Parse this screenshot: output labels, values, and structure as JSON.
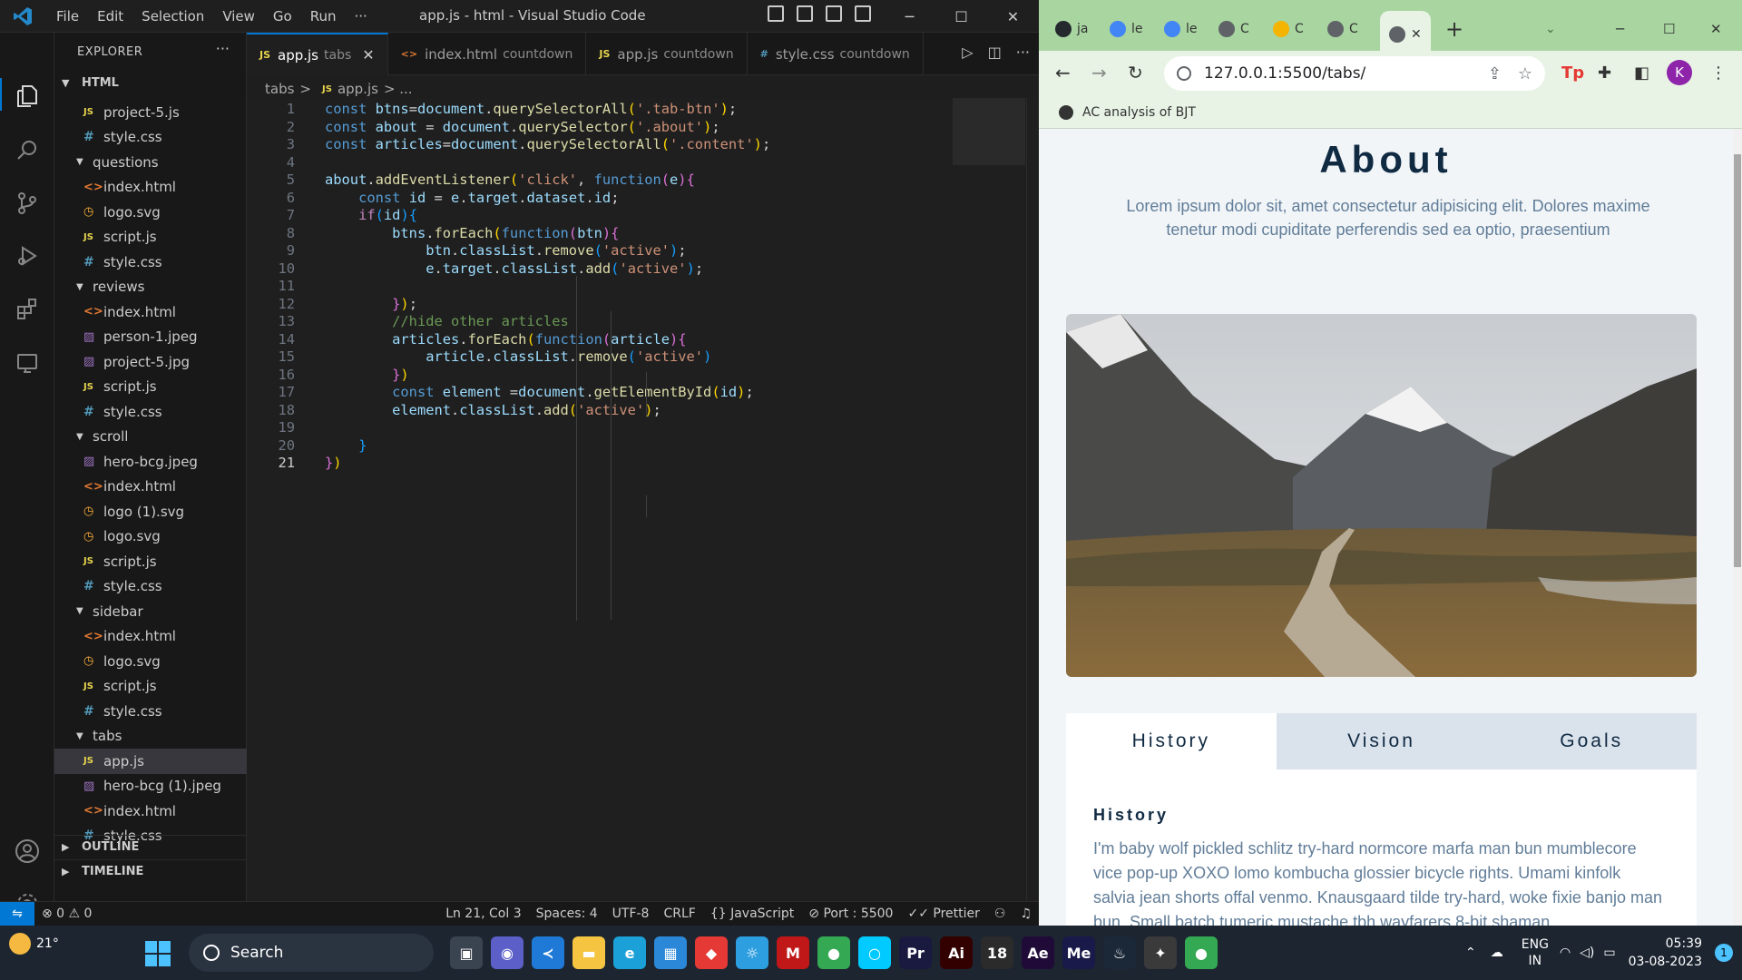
{
  "vscode": {
    "menu": [
      "File",
      "Edit",
      "Selection",
      "View",
      "Go",
      "Run",
      "···"
    ],
    "title": "app.js - html - Visual Studio Code",
    "explorer_title": "EXPLORER",
    "more": "···",
    "root_folder": "HTML",
    "tree": [
      {
        "type": "file",
        "icon": "js",
        "name": "project-5.js"
      },
      {
        "type": "file",
        "icon": "css",
        "name": "style.css"
      },
      {
        "type": "folder",
        "name": "questions"
      },
      {
        "type": "file",
        "icon": "html",
        "name": "index.html"
      },
      {
        "type": "file",
        "icon": "svg",
        "name": "logo.svg"
      },
      {
        "type": "file",
        "icon": "js",
        "name": "script.js"
      },
      {
        "type": "file",
        "icon": "css",
        "name": "style.css"
      },
      {
        "type": "folder",
        "name": "reviews"
      },
      {
        "type": "file",
        "icon": "html",
        "name": "index.html"
      },
      {
        "type": "file",
        "icon": "img",
        "name": "person-1.jpeg"
      },
      {
        "type": "file",
        "icon": "img",
        "name": "project-5.jpg"
      },
      {
        "type": "file",
        "icon": "js",
        "name": "script.js"
      },
      {
        "type": "file",
        "icon": "css",
        "name": "style.css"
      },
      {
        "type": "folder",
        "name": "scroll"
      },
      {
        "type": "file",
        "icon": "img",
        "name": "hero-bcg.jpeg"
      },
      {
        "type": "file",
        "icon": "html",
        "name": "index.html"
      },
      {
        "type": "file",
        "icon": "svg",
        "name": "logo (1).svg"
      },
      {
        "type": "file",
        "icon": "svg",
        "name": "logo.svg"
      },
      {
        "type": "file",
        "icon": "js",
        "name": "script.js"
      },
      {
        "type": "file",
        "icon": "css",
        "name": "style.css"
      },
      {
        "type": "folder",
        "name": "sidebar"
      },
      {
        "type": "file",
        "icon": "html",
        "name": "index.html"
      },
      {
        "type": "file",
        "icon": "svg",
        "name": "logo.svg"
      },
      {
        "type": "file",
        "icon": "js",
        "name": "script.js"
      },
      {
        "type": "file",
        "icon": "css",
        "name": "style.css"
      },
      {
        "type": "folder",
        "name": "tabs"
      },
      {
        "type": "file",
        "icon": "js",
        "name": "app.js",
        "selected": true
      },
      {
        "type": "file",
        "icon": "img",
        "name": "hero-bcg (1).jpeg"
      },
      {
        "type": "file",
        "icon": "html",
        "name": "index.html"
      },
      {
        "type": "file",
        "icon": "css",
        "name": "style.css"
      }
    ],
    "outline": "OUTLINE",
    "timeline": "TIMELINE",
    "tabs": [
      {
        "icon": "JS",
        "icon_color": "#e8d44d",
        "name": "app.js",
        "desc": "tabs",
        "active": true
      },
      {
        "icon": "<>",
        "icon_color": "#e37933",
        "name": "index.html",
        "desc": "countdown",
        "active": false
      },
      {
        "icon": "JS",
        "icon_color": "#e8d44d",
        "name": "app.js",
        "desc": "countdown",
        "active": false
      },
      {
        "icon": "#",
        "icon_color": "#519aba",
        "name": "style.css",
        "desc": "countdown",
        "active": false
      }
    ],
    "breadcrumb": {
      "folder": "tabs",
      "sep": ">",
      "file": "app.js",
      "tail": "> ..."
    },
    "current_line": 21,
    "code_lines": [
      [
        [
          "kw",
          "const "
        ],
        [
          "var",
          "btns"
        ],
        [
          "plain",
          "="
        ],
        [
          "var",
          "document"
        ],
        [
          "plain",
          "."
        ],
        [
          "fn",
          "querySelectorAll"
        ],
        [
          "br1",
          "("
        ],
        [
          "str",
          "'.tab-btn'"
        ],
        [
          "br1",
          ")"
        ],
        [
          "plain",
          ";"
        ]
      ],
      [
        [
          "kw",
          "const "
        ],
        [
          "var",
          "about"
        ],
        [
          "plain",
          " = "
        ],
        [
          "var",
          "document"
        ],
        [
          "plain",
          "."
        ],
        [
          "fn",
          "querySelector"
        ],
        [
          "br1",
          "("
        ],
        [
          "str",
          "'.about'"
        ],
        [
          "br1",
          ")"
        ],
        [
          "plain",
          ";"
        ]
      ],
      [
        [
          "kw",
          "const "
        ],
        [
          "var",
          "articles"
        ],
        [
          "plain",
          "="
        ],
        [
          "var",
          "document"
        ],
        [
          "plain",
          "."
        ],
        [
          "fn",
          "querySelectorAll"
        ],
        [
          "br1",
          "("
        ],
        [
          "str",
          "'.content'"
        ],
        [
          "br1",
          ")"
        ],
        [
          "plain",
          ";"
        ]
      ],
      [],
      [
        [
          "var",
          "about"
        ],
        [
          "plain",
          "."
        ],
        [
          "fn",
          "addEventListener"
        ],
        [
          "br1",
          "("
        ],
        [
          "str",
          "'click'"
        ],
        [
          "plain",
          ", "
        ],
        [
          "kw",
          "function"
        ],
        [
          "br2",
          "("
        ],
        [
          "var",
          "e"
        ],
        [
          "br2",
          ")"
        ],
        [
          "br2",
          "{"
        ]
      ],
      [
        [
          "plain",
          "    "
        ],
        [
          "kw",
          "const "
        ],
        [
          "var",
          "id"
        ],
        [
          "plain",
          " = "
        ],
        [
          "var",
          "e"
        ],
        [
          "plain",
          "."
        ],
        [
          "var",
          "target"
        ],
        [
          "plain",
          "."
        ],
        [
          "var",
          "dataset"
        ],
        [
          "plain",
          "."
        ],
        [
          "var",
          "id"
        ],
        [
          "plain",
          ";"
        ]
      ],
      [
        [
          "plain",
          "    "
        ],
        [
          "kw2",
          "if"
        ],
        [
          "br3",
          "("
        ],
        [
          "var",
          "id"
        ],
        [
          "br3",
          ")"
        ],
        [
          "br3",
          "{"
        ]
      ],
      [
        [
          "plain",
          "        "
        ],
        [
          "var",
          "btns"
        ],
        [
          "plain",
          "."
        ],
        [
          "fn",
          "forEach"
        ],
        [
          "br1",
          "("
        ],
        [
          "kw",
          "function"
        ],
        [
          "br2",
          "("
        ],
        [
          "var",
          "btn"
        ],
        [
          "br2",
          ")"
        ],
        [
          "br2",
          "{"
        ]
      ],
      [
        [
          "plain",
          "            "
        ],
        [
          "var",
          "btn"
        ],
        [
          "plain",
          "."
        ],
        [
          "var",
          "classList"
        ],
        [
          "plain",
          "."
        ],
        [
          "fn",
          "remove"
        ],
        [
          "br3",
          "("
        ],
        [
          "str",
          "'active'"
        ],
        [
          "br3",
          ")"
        ],
        [
          "plain",
          ";"
        ]
      ],
      [
        [
          "plain",
          "            "
        ],
        [
          "var",
          "e"
        ],
        [
          "plain",
          "."
        ],
        [
          "var",
          "target"
        ],
        [
          "plain",
          "."
        ],
        [
          "var",
          "classList"
        ],
        [
          "plain",
          "."
        ],
        [
          "fn",
          "add"
        ],
        [
          "br3",
          "("
        ],
        [
          "str",
          "'active'"
        ],
        [
          "br3",
          ")"
        ],
        [
          "plain",
          ";"
        ]
      ],
      [],
      [
        [
          "plain",
          "        "
        ],
        [
          "br2",
          "}"
        ],
        [
          "br1",
          ")"
        ],
        [
          "plain",
          ";"
        ]
      ],
      [
        [
          "plain",
          "        "
        ],
        [
          "cm",
          "//hide other articles"
        ]
      ],
      [
        [
          "plain",
          "        "
        ],
        [
          "var",
          "articles"
        ],
        [
          "plain",
          "."
        ],
        [
          "fn",
          "forEach"
        ],
        [
          "br1",
          "("
        ],
        [
          "kw",
          "function"
        ],
        [
          "br2",
          "("
        ],
        [
          "var",
          "article"
        ],
        [
          "br2",
          ")"
        ],
        [
          "br2",
          "{"
        ]
      ],
      [
        [
          "plain",
          "            "
        ],
        [
          "var",
          "article"
        ],
        [
          "plain",
          "."
        ],
        [
          "var",
          "classList"
        ],
        [
          "plain",
          "."
        ],
        [
          "fn",
          "remove"
        ],
        [
          "br3",
          "("
        ],
        [
          "str",
          "'active'"
        ],
        [
          "br3",
          ")"
        ]
      ],
      [
        [
          "plain",
          "        "
        ],
        [
          "br2",
          "}"
        ],
        [
          "br1",
          ")"
        ]
      ],
      [
        [
          "plain",
          "        "
        ],
        [
          "kw",
          "const "
        ],
        [
          "var",
          "element"
        ],
        [
          "plain",
          " ="
        ],
        [
          "var",
          "document"
        ],
        [
          "plain",
          "."
        ],
        [
          "fn",
          "getElementById"
        ],
        [
          "br1",
          "("
        ],
        [
          "var",
          "id"
        ],
        [
          "br1",
          ")"
        ],
        [
          "plain",
          ";"
        ]
      ],
      [
        [
          "plain",
          "        "
        ],
        [
          "var",
          "element"
        ],
        [
          "plain",
          "."
        ],
        [
          "var",
          "classList"
        ],
        [
          "plain",
          "."
        ],
        [
          "fn",
          "add"
        ],
        [
          "br1",
          "("
        ],
        [
          "str",
          "'active'"
        ],
        [
          "br1",
          ")"
        ],
        [
          "plain",
          ";"
        ]
      ],
      [],
      [
        [
          "plain",
          "    "
        ],
        [
          "br3",
          "}"
        ]
      ],
      [
        [
          "br2",
          "}"
        ],
        [
          "br1",
          ")"
        ]
      ]
    ],
    "status": {
      "errors": "⊗ 0 ⚠ 0",
      "position": "Ln 21, Col 3",
      "spaces": "Spaces: 4",
      "encoding": "UTF-8",
      "eol": "CRLF",
      "language": "{} JavaScript",
      "port": "⊘ Port : 5500",
      "prettier": "✓✓ Prettier"
    }
  },
  "chrome": {
    "tabs": [
      {
        "label": "ja",
        "fav": "#24292e"
      },
      {
        "label": "le",
        "fav": "#4285f4"
      },
      {
        "label": "le",
        "fav": "#4285f4"
      },
      {
        "label": "C",
        "fav": "#5f6368"
      },
      {
        "label": "C",
        "fav": "#f4b400"
      },
      {
        "label": "C",
        "fav": "#5f6368"
      }
    ],
    "active_tab_close": "✕",
    "new_tab": "+",
    "url": "127.0.0.1:5500/tabs/",
    "profile_initial": "K",
    "bookmark": "AC analysis of BJT"
  },
  "page": {
    "title": "About",
    "subtitle": "Lorem ipsum dolor sit, amet consectetur adipisicing elit. Dolores maxime tenetur modi cupiditate perferendis sed ea optio, praesentium",
    "tab_buttons": [
      {
        "label": "History",
        "active": true
      },
      {
        "label": "Vision",
        "active": false
      },
      {
        "label": "Goals",
        "active": false
      }
    ],
    "content_title": "History",
    "content_text": "I'm baby wolf pickled schlitz try-hard normcore marfa man bun mumblecore vice pop-up XOXO lomo kombucha glossier bicycle rights. Umami kinfolk salvia jean shorts offal venmo. Knausgaard tilde try-hard, woke fixie banjo man bun. Small batch tumeric mustache tbh wayfarers 8-bit shaman"
  },
  "taskbar": {
    "temp": "21°",
    "search_placeholder": "Search",
    "apps": [
      {
        "name": "task-view",
        "label": "▣",
        "color": "#3a4350"
      },
      {
        "name": "zoom",
        "label": "◉",
        "color": "#5b5fc7"
      },
      {
        "name": "vscode",
        "label": "≺",
        "color": "#1e7ad6"
      },
      {
        "name": "explorer",
        "label": "▬",
        "color": "#f5c542"
      },
      {
        "name": "edge",
        "label": "e",
        "color": "#1ba0d8"
      },
      {
        "name": "store",
        "label": "▦",
        "color": "#2b88d8"
      },
      {
        "name": "app-red",
        "label": "◆",
        "color": "#e53935"
      },
      {
        "name": "app-yellow",
        "label": "☼",
        "color": "#2d9ee0"
      },
      {
        "name": "mcafee",
        "label": "M",
        "color": "#c01818"
      },
      {
        "name": "chrome",
        "label": "●",
        "color": "#34a853"
      },
      {
        "name": "alexa",
        "label": "○",
        "color": "#00caff"
      },
      {
        "name": "premiere",
        "label": "Pr",
        "color": "#1a1a40"
      },
      {
        "name": "illustrator",
        "label": "Ai",
        "color": "#330000"
      },
      {
        "name": "app-18",
        "label": "18",
        "color": "#2b2b2b"
      },
      {
        "name": "after-effects",
        "label": "Ae",
        "color": "#1f0a38"
      },
      {
        "name": "media-encoder",
        "label": "Me",
        "color": "#1a1a4a"
      },
      {
        "name": "steam",
        "label": "♨",
        "color": "#1b2838"
      },
      {
        "name": "app-colorful",
        "label": "✦",
        "color": "#3a3a3a"
      },
      {
        "name": "chrome-profile",
        "label": "●",
        "color": "#34a853"
      }
    ],
    "lang": "ENG",
    "region": "IN",
    "time": "05:39",
    "date": "03-08-2023",
    "notif": "1"
  }
}
